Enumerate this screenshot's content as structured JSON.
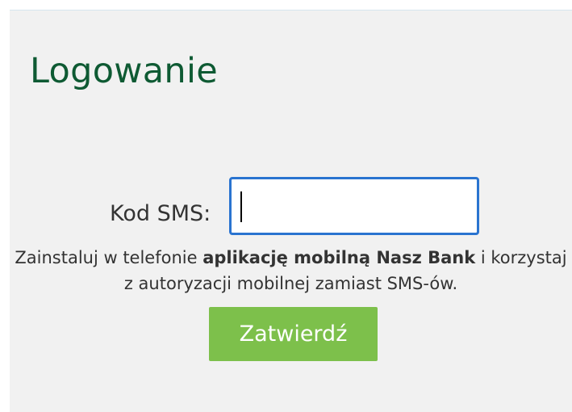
{
  "page": {
    "title": "Logowanie"
  },
  "form": {
    "sms_label": "Kod SMS:",
    "sms_value": "",
    "info_before": "Zainstaluj w telefonie ",
    "info_bold": "aplikację mobilną Nasz Bank",
    "info_after": " i korzystaj z autoryzacji mobilnej zamiast SMS-ów.",
    "submit_label": "Zatwierdź"
  },
  "colors": {
    "title": "#0e5a33",
    "accent_button": "#7dc04b",
    "input_focus_border": "#2a74d0",
    "panel_background": "#f1f1f1"
  }
}
